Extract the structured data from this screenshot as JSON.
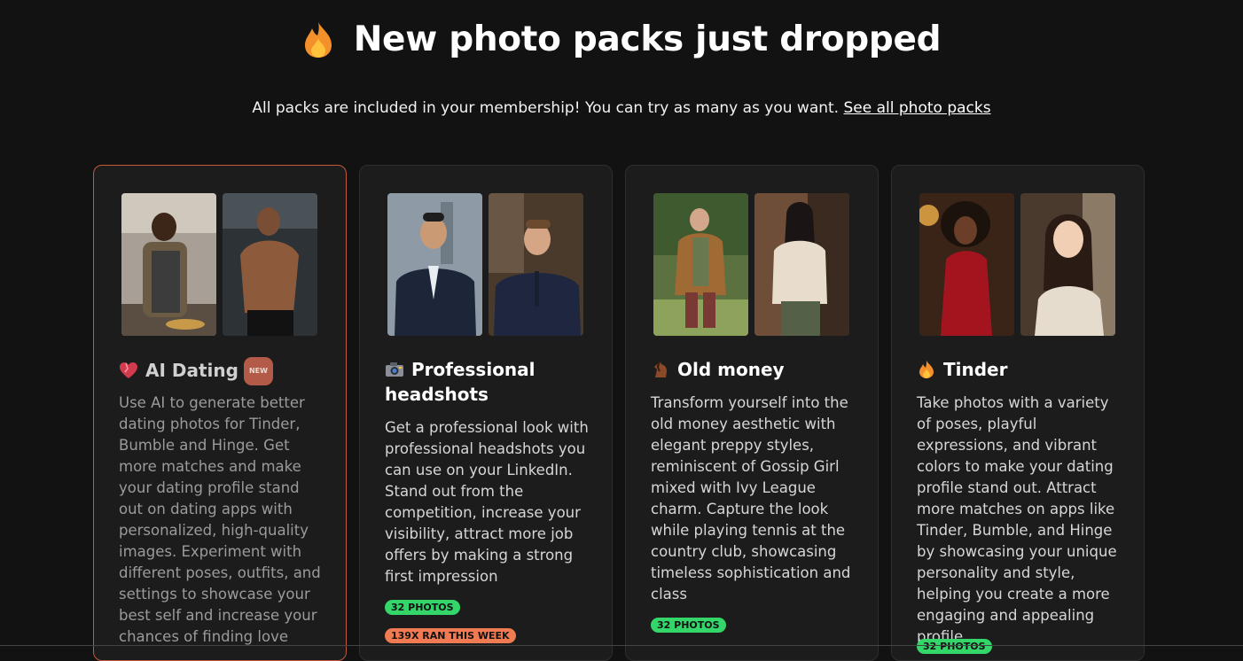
{
  "header": {
    "title": "New photo packs just dropped",
    "icon": "fire-icon",
    "subtitle": "All packs are included in your membership! You can try as many as you want.",
    "link": "See all photo packs"
  },
  "cards": [
    {
      "icon": "heart-icon",
      "title": "AI Dating",
      "badge": "NEW",
      "description": "Use AI to generate better dating photos for Tinder, Bumble and Hinge. Get more matches and make your dating profile stand out on dating apps with personalized, high-quality images. Experiment with different poses, outfits, and settings to showcase your best self and increase your chances of finding love",
      "tags": []
    },
    {
      "icon": "camera-icon",
      "title": "Professional headshots",
      "description": "Get a professional look with professional headshots you can use on your LinkedIn. Stand out from the competition, increase your visibility, attract more job offers by making a strong first impression",
      "tags": [
        "32 PHOTOS",
        "139X RAN THIS WEEK"
      ]
    },
    {
      "icon": "horse-icon",
      "title": "Old money",
      "description": "Transform yourself into the old money aesthetic with elegant preppy styles, reminiscent of Gossip Girl mixed with Ivy League charm. Capture the look while playing tennis at the country club, showcasing timeless sophistication and class",
      "tags": [
        "32 PHOTOS"
      ]
    },
    {
      "icon": "fire-icon",
      "title": "Tinder",
      "description": "Take photos with a variety of poses, playful expressions, and vibrant colors to make your dating profile stand out. Attract more matches on apps like Tinder, Bumble, and Hinge by showcasing your unique personality and style, helping you create a more engaging and appealing profile",
      "tags": [
        "32 PHOTOS"
      ]
    }
  ],
  "colors": {
    "background": "#121212",
    "card": "#1c1c1c",
    "active_border": "#c4583c",
    "tag_green": "#34d66a",
    "tag_orange": "#f07a52"
  }
}
